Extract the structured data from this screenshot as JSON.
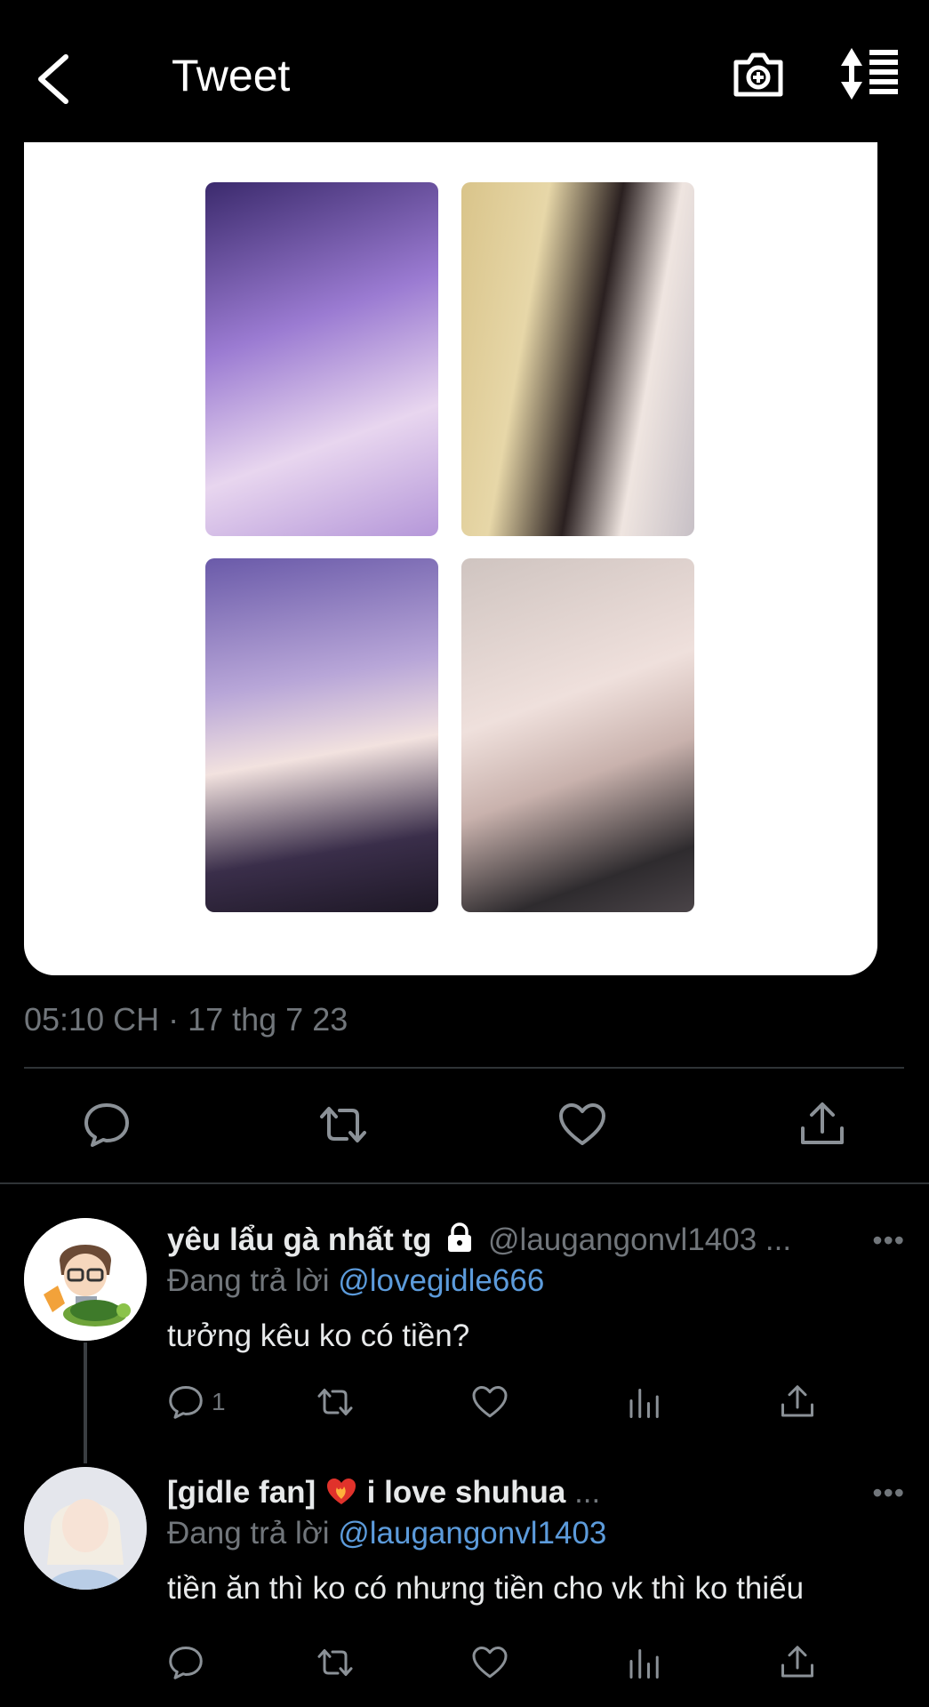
{
  "header": {
    "title": "Tweet"
  },
  "tweet": {
    "timestamp": "05:10 CH · 17 thg 7 23"
  },
  "replies": [
    {
      "name": "yêu lẩu gà nhất tg",
      "handle": "@laugangonvl1403 ...",
      "more": "•••",
      "replying_prefix": "Đang trả lời",
      "replying_to": "@lovegidle666",
      "text": "tưởng kêu ko có tiền?",
      "reply_count": "1"
    },
    {
      "name": "[gidle fan]  ",
      "name_suffix": " i love shuhua",
      "handle": " ...",
      "more": "•••",
      "replying_prefix": "Đang trả lời",
      "replying_to": "@laugangonvl1403",
      "text": "tiền ăn thì ko có nhưng tiền cho vk thì ko thiếu",
      "reply_count": ""
    }
  ],
  "colors": {
    "background": "#000000",
    "text": "#e7e9ea",
    "muted": "#71767b",
    "link": "#5c9bdb"
  }
}
